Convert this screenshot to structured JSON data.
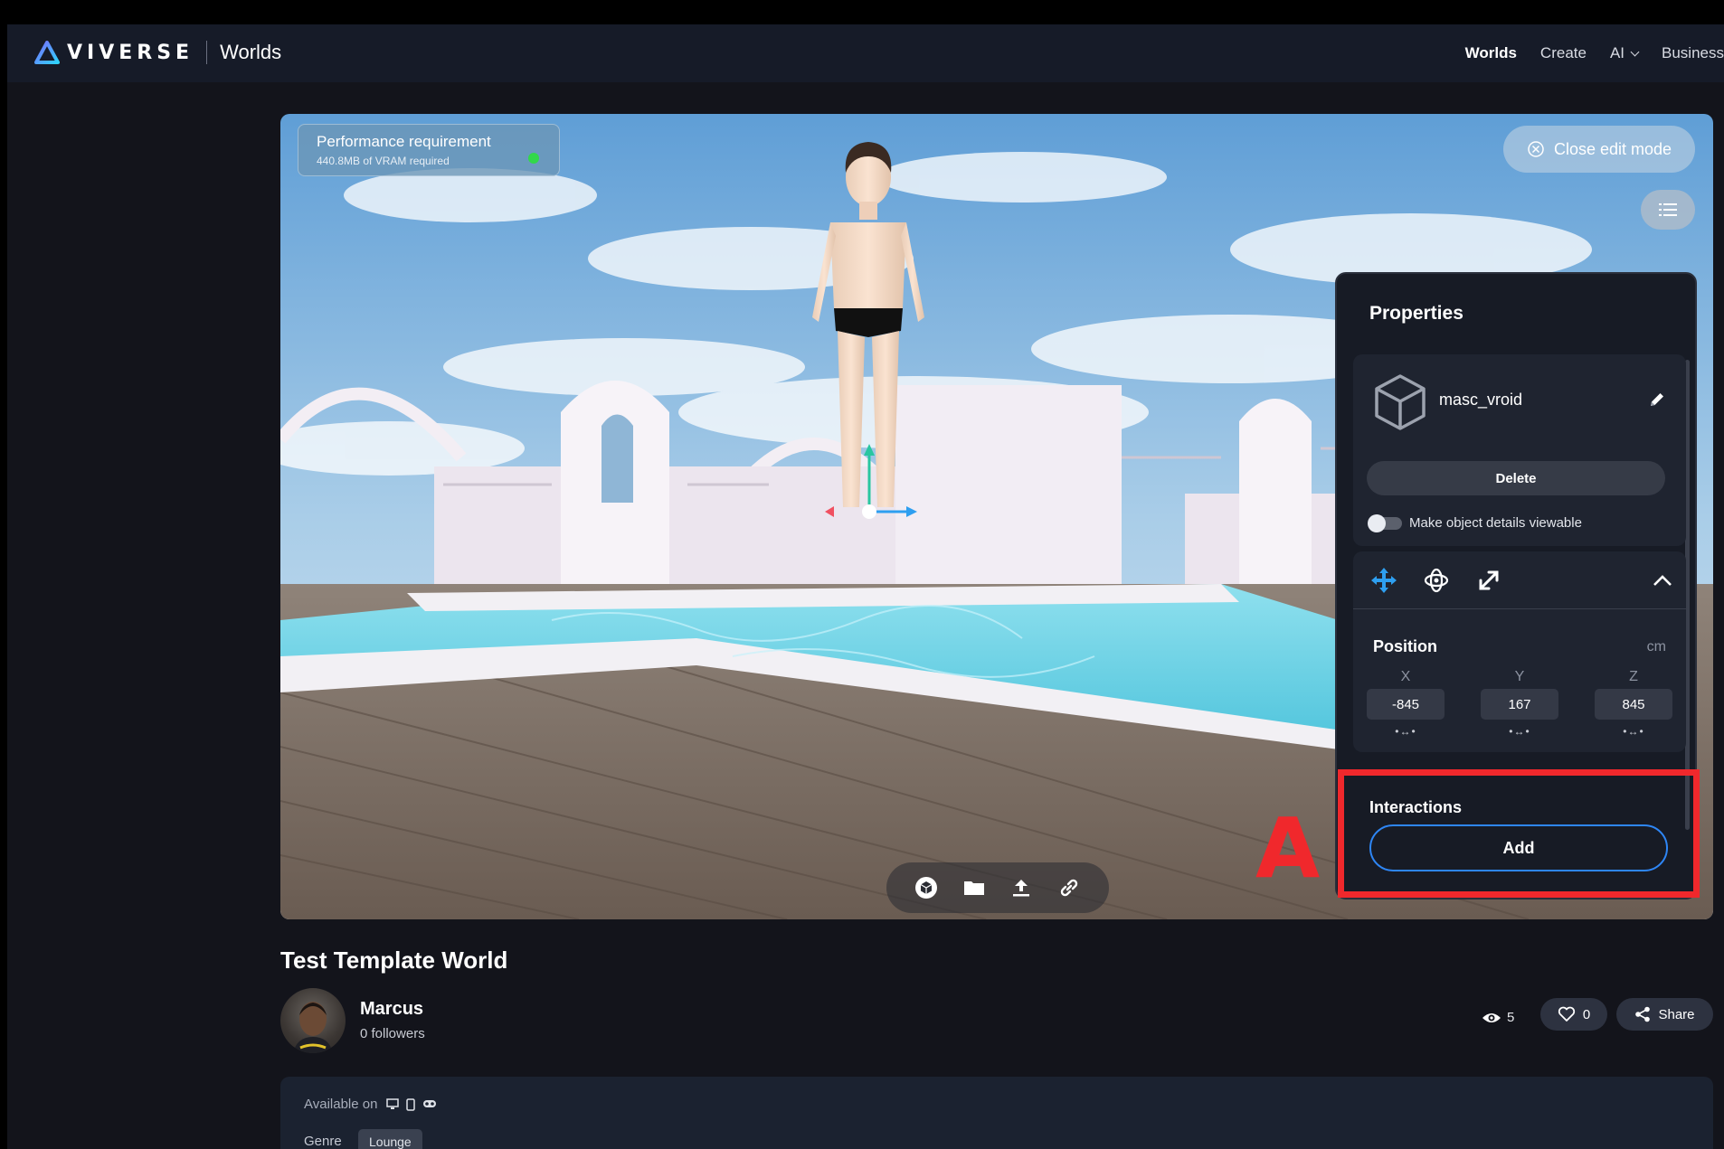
{
  "header": {
    "brand": "VIVERSE",
    "section": "Worlds",
    "nav": [
      {
        "label": "Worlds",
        "active": true
      },
      {
        "label": "Create",
        "active": false
      },
      {
        "label": "AI",
        "has_dropdown": true
      },
      {
        "label": "Business",
        "active": false
      }
    ]
  },
  "viewport": {
    "performance": {
      "title": "Performance requirement",
      "detail": "440.8MB of VRAM required",
      "status_color": "#32d84a"
    },
    "close_edit_mode": "Close edit mode",
    "list_button_icon": "list-icon",
    "toolbar": [
      "cube-icon",
      "folder-icon",
      "upload-icon",
      "link-icon"
    ]
  },
  "properties": {
    "title": "Properties",
    "object": {
      "icon": "cube-outline-icon",
      "name": "masc_vroid",
      "delete_label": "Delete",
      "details_toggle_label": "Make object details viewable",
      "details_toggle_on": false
    },
    "transform": {
      "modes": [
        "move-icon",
        "rotate-icon",
        "scale-icon"
      ],
      "active_mode": "move-icon",
      "position_label": "Position",
      "unit": "cm",
      "axes": [
        {
          "axis": "X",
          "value": "-845"
        },
        {
          "axis": "Y",
          "value": "167"
        },
        {
          "axis": "Z",
          "value": "845"
        }
      ]
    },
    "interactions": {
      "label": "Interactions",
      "add_label": "Add"
    }
  },
  "annotation": {
    "marker": "A",
    "color": "#f0282c"
  },
  "world": {
    "title": "Test Template World",
    "author": "Marcus",
    "followers": "0 followers",
    "views": "5",
    "likes": "0",
    "share_label": "Share",
    "available_on_label": "Available on",
    "platforms": [
      "desktop-icon",
      "mobile-icon",
      "vr-headset-icon"
    ],
    "genre_label": "Genre",
    "genre": "Lounge"
  },
  "colors": {
    "accent": "#2e86f5",
    "background": "#13141b",
    "header": "#161b28"
  }
}
